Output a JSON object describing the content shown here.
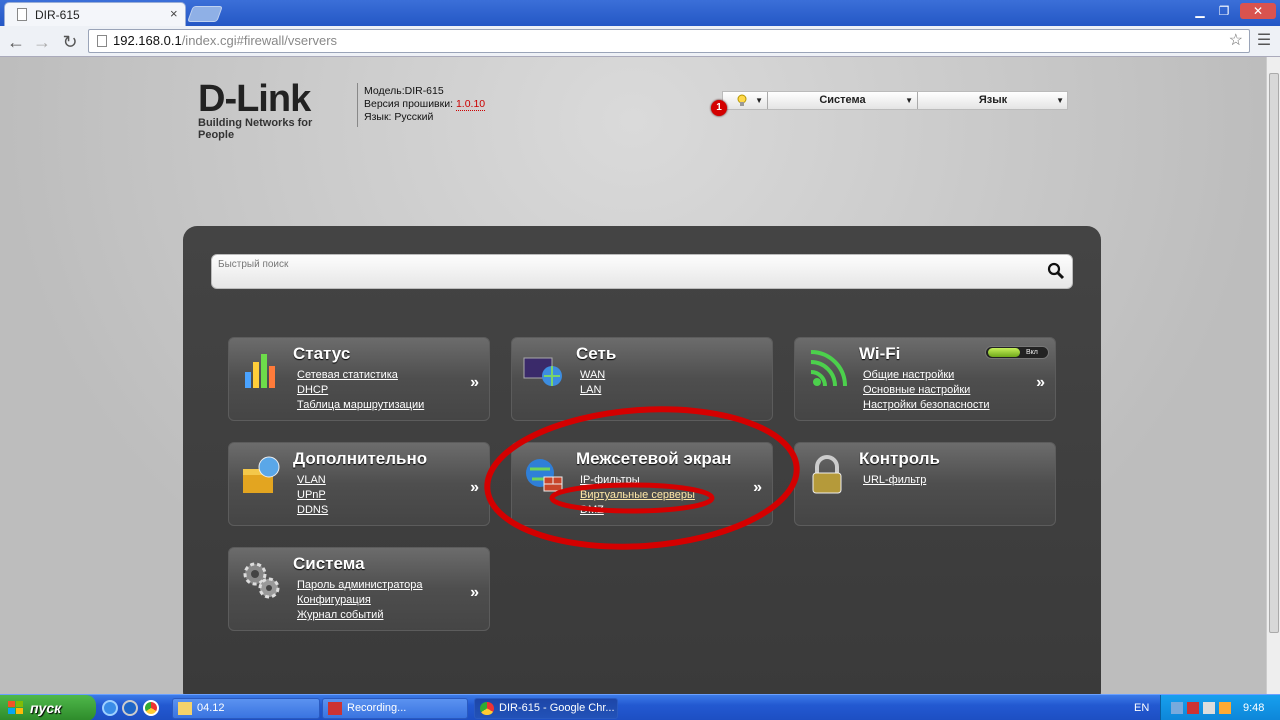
{
  "browser": {
    "tab_title": "DIR-615",
    "tab_close": "×",
    "url_host": "192.168.0.1",
    "url_path": "/index.cgi#firewall/vservers",
    "win_min": "▁",
    "win_max": "❐",
    "win_close": "✕"
  },
  "header": {
    "logo_text": "D-Link",
    "logo_tagline": "Building Networks for People",
    "model_label": "Модель:DIR-615",
    "firmware_label": "Версия прошивки:",
    "firmware_version": "1.0.10",
    "language_label": "Язык: Русский",
    "notification_count": "1",
    "menu_system": "Система",
    "menu_language": "Язык"
  },
  "search": {
    "placeholder": "Быстрый поиск"
  },
  "cards": {
    "status": {
      "title": "Статус",
      "links": [
        "Сетевая статистика",
        "DHCP",
        "Таблица маршрутизации"
      ],
      "go": "»"
    },
    "network": {
      "title": "Сеть",
      "links": [
        "WAN",
        "LAN"
      ],
      "go": ""
    },
    "wifi": {
      "title": "Wi-Fi",
      "links": [
        "Общие настройки",
        "Основные настройки",
        "Настройки безопасности"
      ],
      "go": "»",
      "toggle": "Вкл"
    },
    "advanced": {
      "title": "Дополнительно",
      "links": [
        "VLAN",
        "UPnP",
        "DDNS"
      ],
      "go": "»"
    },
    "firewall": {
      "title": "Межсетевой экран",
      "links": [
        "IP-фильтры",
        "Виртуальные серверы",
        "DMZ"
      ],
      "go": "»"
    },
    "control": {
      "title": "Контроль",
      "links": [
        "URL-фильтр"
      ],
      "go": ""
    },
    "system": {
      "title": "Система",
      "links": [
        "Пароль администратора",
        "Конфигурация",
        "Журнал событий"
      ],
      "go": "»"
    }
  },
  "taskbar": {
    "start_label": "пуск",
    "tasks": [
      "04.12",
      "Recording...",
      "DIR-615 - Google Chr..."
    ],
    "lang": "EN",
    "clock": "9:48"
  },
  "colors": {
    "accent_red": "#d40000",
    "panel": "#3f3f3f",
    "taskbar": "#245edb"
  }
}
